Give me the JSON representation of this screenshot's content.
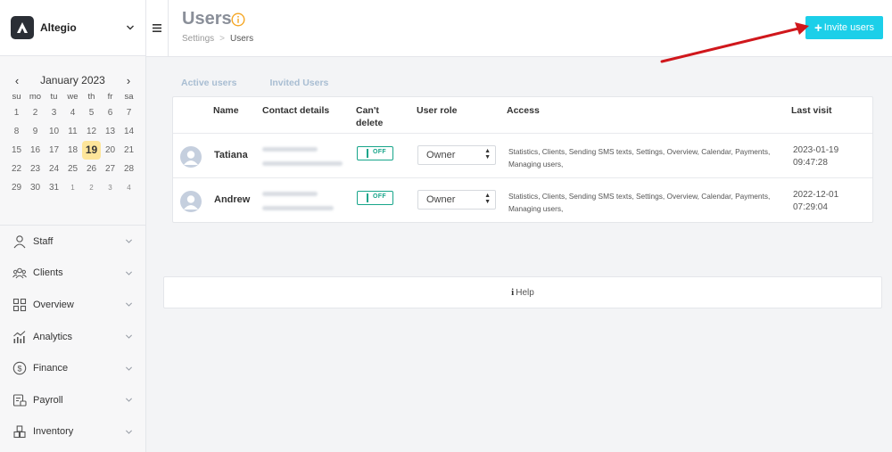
{
  "brand": {
    "name": "Altegio"
  },
  "calendar": {
    "month_label": "January 2023",
    "prev": "‹",
    "next": "›",
    "weekdays": [
      "su",
      "mo",
      "tu",
      "we",
      "th",
      "fr",
      "sa"
    ],
    "weeks": [
      [
        "1",
        "2",
        "3",
        "4",
        "5",
        "6",
        "7"
      ],
      [
        "8",
        "9",
        "10",
        "11",
        "12",
        "13",
        "14"
      ],
      [
        "15",
        "16",
        "17",
        "18",
        "19",
        "20",
        "21"
      ],
      [
        "22",
        "23",
        "24",
        "25",
        "26",
        "27",
        "28"
      ],
      [
        "29",
        "30",
        "31",
        "1",
        "2",
        "3",
        "4"
      ]
    ],
    "today": "19"
  },
  "nav": [
    {
      "label": "Staff",
      "icon": "person-icon"
    },
    {
      "label": "Clients",
      "icon": "clients-icon"
    },
    {
      "label": "Overview",
      "icon": "grid-icon"
    },
    {
      "label": "Analytics",
      "icon": "analytics-icon"
    },
    {
      "label": "Finance",
      "icon": "dollar-icon"
    },
    {
      "label": "Payroll",
      "icon": "payroll-icon"
    },
    {
      "label": "Inventory",
      "icon": "inventory-icon"
    }
  ],
  "header": {
    "title": "Users",
    "breadcrumb": {
      "parent": "Settings",
      "separator": ">",
      "current": "Users"
    },
    "invite_label": "Invite users",
    "invite_icon": "+"
  },
  "tabs": [
    "Active users",
    "Invited Users"
  ],
  "table": {
    "columns": {
      "name": "Name",
      "contact": "Contact details",
      "cant_delete_1": "Can't",
      "cant_delete_2": "delete",
      "role": "User role",
      "access": "Access",
      "last_visit": "Last visit"
    },
    "rows": [
      {
        "name": "Tatiana",
        "cant_delete": "OFF",
        "role": "Owner",
        "access_1": "Statistics, Clients, Sending SMS texts, Settings, Overview, Calendar, Payments,",
        "access_2": "Managing users,",
        "visit_date": "2023-01-19",
        "visit_time": "09:47:28"
      },
      {
        "name": "Andrew",
        "cant_delete": "OFF",
        "role": "Owner",
        "access_1": "Statistics, Clients, Sending SMS texts, Settings, Overview, Calendar, Payments,",
        "access_2": "Managing users,",
        "visit_date": "2022-12-01",
        "visit_time": "07:29:04"
      }
    ]
  },
  "help": {
    "icon": "i",
    "label": "Help"
  },
  "colors": {
    "accent": "#1ccfe9",
    "toggle": "#17a58a",
    "today": "#fde59a",
    "annotation_arrow": "#d0171c"
  }
}
